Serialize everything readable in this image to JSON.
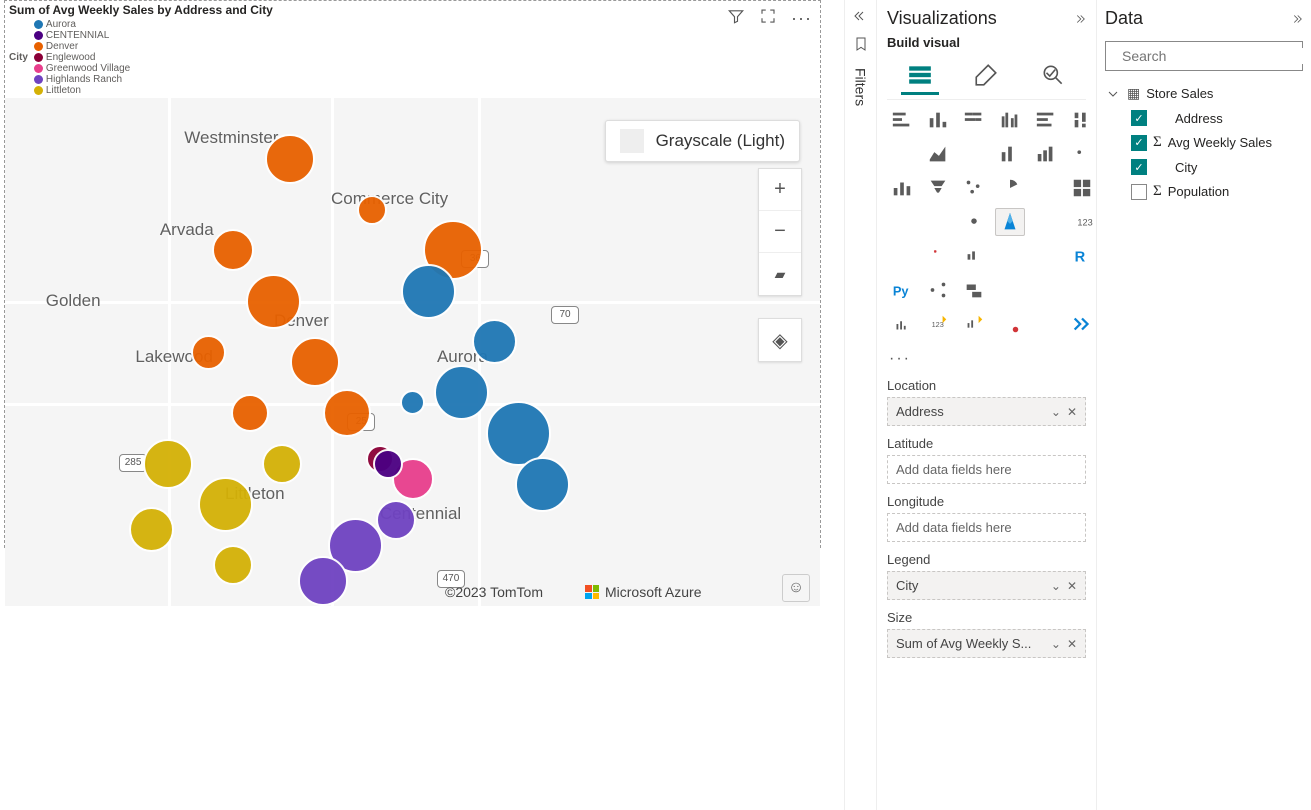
{
  "visual": {
    "title": "Sum of Avg Weekly Sales by Address and City",
    "legend_label": "City",
    "legend_items": [
      {
        "label": "Aurora",
        "color": "#1f77b4"
      },
      {
        "label": "CENTENNIAL",
        "color": "#4b0082"
      },
      {
        "label": "Denver",
        "color": "#e86100"
      },
      {
        "label": "Englewood",
        "color": "#8b0037"
      },
      {
        "label": "Greenwood Village",
        "color": "#e83e8c"
      },
      {
        "label": "Highlands Ranch",
        "color": "#6f42c1"
      },
      {
        "label": "Littleton",
        "color": "#d4b106"
      }
    ],
    "style_name": "Grayscale (Light)",
    "shields": [
      "36",
      "70",
      "25",
      "285",
      "470"
    ],
    "city_labels": [
      "Westminster",
      "Commerce City",
      "Arvada",
      "Denver",
      "Golden",
      "Lakewood",
      "Aurora",
      "Littleton",
      "Centennial"
    ],
    "attrib_tomtom": "©2023 TomTom",
    "attrib_msazure": "Microsoft Azure"
  },
  "filters_label": "Filters",
  "viz_panel": {
    "title": "Visualizations",
    "subtitle": "Build visual",
    "more": "···",
    "wells": [
      {
        "label": "Location",
        "value": "Address",
        "filled": true
      },
      {
        "label": "Latitude",
        "value": "Add data fields here",
        "filled": false
      },
      {
        "label": "Longitude",
        "value": "Add data fields here",
        "filled": false
      },
      {
        "label": "Legend",
        "value": "City",
        "filled": true
      },
      {
        "label": "Size",
        "value": "Sum of Avg Weekly S...",
        "filled": true
      }
    ]
  },
  "data_panel": {
    "title": "Data",
    "search_placeholder": "Search",
    "table": "Store Sales",
    "fields": [
      {
        "name": "Address",
        "checked": true,
        "sigma": false
      },
      {
        "name": "Avg Weekly Sales",
        "checked": true,
        "sigma": true
      },
      {
        "name": "City",
        "checked": true,
        "sigma": false
      },
      {
        "name": "Population",
        "checked": false,
        "sigma": true
      }
    ]
  },
  "chart_data": {
    "type": "map-bubbles",
    "title": "Sum of Avg Weekly Sales by Address and City",
    "legend_field": "City",
    "size_field": "Sum of Avg Weekly Sales",
    "series": [
      {
        "name": "Aurora",
        "color": "#1f77b4"
      },
      {
        "name": "CENTENNIAL",
        "color": "#4b0082"
      },
      {
        "name": "Denver",
        "color": "#e86100"
      },
      {
        "name": "Englewood",
        "color": "#8b0037"
      },
      {
        "name": "Greenwood Village",
        "color": "#e83e8c"
      },
      {
        "name": "Highlands Ranch",
        "color": "#6f42c1"
      },
      {
        "name": "Littleton",
        "color": "#d4b106"
      }
    ],
    "bubbles": [
      {
        "city": "Denver",
        "x_pct": 35,
        "y_pct": 12,
        "r": 50
      },
      {
        "city": "Denver",
        "x_pct": 45,
        "y_pct": 22,
        "r": 30
      },
      {
        "city": "Denver",
        "x_pct": 55,
        "y_pct": 30,
        "r": 60
      },
      {
        "city": "Denver",
        "x_pct": 28,
        "y_pct": 30,
        "r": 42
      },
      {
        "city": "Denver",
        "x_pct": 33,
        "y_pct": 40,
        "r": 55
      },
      {
        "city": "Denver",
        "x_pct": 25,
        "y_pct": 50,
        "r": 35
      },
      {
        "city": "Denver",
        "x_pct": 38,
        "y_pct": 52,
        "r": 50
      },
      {
        "city": "Denver",
        "x_pct": 42,
        "y_pct": 62,
        "r": 48
      },
      {
        "city": "Denver",
        "x_pct": 30,
        "y_pct": 62,
        "r": 38
      },
      {
        "city": "Aurora",
        "x_pct": 52,
        "y_pct": 38,
        "r": 55
      },
      {
        "city": "Aurora",
        "x_pct": 60,
        "y_pct": 48,
        "r": 45
      },
      {
        "city": "Aurora",
        "x_pct": 56,
        "y_pct": 58,
        "r": 55
      },
      {
        "city": "Aurora",
        "x_pct": 63,
        "y_pct": 66,
        "r": 65
      },
      {
        "city": "Aurora",
        "x_pct": 50,
        "y_pct": 60,
        "r": 25
      },
      {
        "city": "Aurora",
        "x_pct": 66,
        "y_pct": 76,
        "r": 55
      },
      {
        "city": "Littleton",
        "x_pct": 20,
        "y_pct": 72,
        "r": 50
      },
      {
        "city": "Littleton",
        "x_pct": 27,
        "y_pct": 80,
        "r": 55
      },
      {
        "city": "Littleton",
        "x_pct": 18,
        "y_pct": 85,
        "r": 45
      },
      {
        "city": "Littleton",
        "x_pct": 34,
        "y_pct": 72,
        "r": 40
      },
      {
        "city": "Littleton",
        "x_pct": 28,
        "y_pct": 92,
        "r": 40
      },
      {
        "city": "Greenwood Village",
        "x_pct": 50,
        "y_pct": 75,
        "r": 42
      },
      {
        "city": "Englewood",
        "x_pct": 46,
        "y_pct": 71,
        "r": 28
      },
      {
        "city": "Highlands Ranch",
        "x_pct": 43,
        "y_pct": 88,
        "r": 55
      },
      {
        "city": "Highlands Ranch",
        "x_pct": 39,
        "y_pct": 95,
        "r": 50
      },
      {
        "city": "Highlands Ranch",
        "x_pct": 48,
        "y_pct": 83,
        "r": 40
      },
      {
        "city": "CENTENNIAL",
        "x_pct": 47,
        "y_pct": 72,
        "r": 30
      }
    ]
  }
}
